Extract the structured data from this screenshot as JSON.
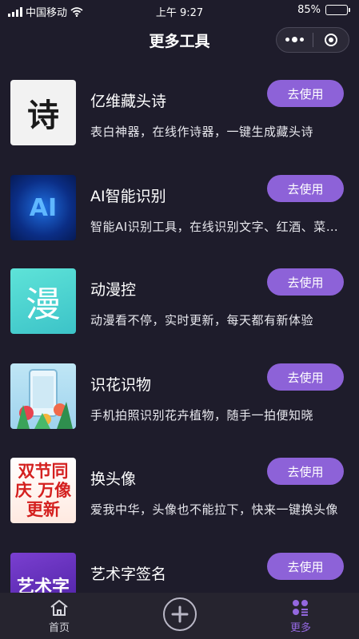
{
  "status": {
    "carrier": "中国移动",
    "time": "上午 9:27",
    "battery": "85%",
    "battery_level": 0.85
  },
  "nav": {
    "title": "更多工具"
  },
  "tools": [
    {
      "title": "亿维藏头诗",
      "desc": "表白神器，在线作诗器，一键生成藏头诗",
      "button": "去使用",
      "thumb_text": "诗"
    },
    {
      "title": "AI智能识别",
      "desc": "智能AI识别工具，在线识别文字、红酒、菜品等",
      "button": "去使用",
      "thumb_text": "AI"
    },
    {
      "title": "动漫控",
      "desc": "动漫看不停，实时更新，每天都有新体验",
      "button": "去使用",
      "thumb_text": "漫"
    },
    {
      "title": "识花识物",
      "desc": "手机拍照识别花卉植物，随手一拍便知晓",
      "button": "去使用",
      "thumb_text": ""
    },
    {
      "title": "换头像",
      "desc": "爱我中华，头像也不能拉下，快来一键换头像",
      "button": "去使用",
      "thumb_text": "双节同庆 万像更新"
    },
    {
      "title": "艺术字签名",
      "desc": "",
      "button": "去使用",
      "thumb_text": "艺术字"
    }
  ],
  "tabbar": {
    "home": "首页",
    "more": "更多"
  },
  "colors": {
    "background": "#1e1c2b",
    "accent": "#8d62d8",
    "active_tab": "#9468e0"
  }
}
